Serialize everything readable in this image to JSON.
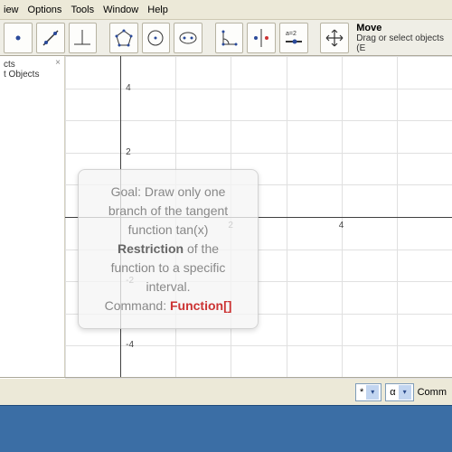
{
  "menu": {
    "items": [
      "iew",
      "Options",
      "Tools",
      "Window",
      "Help"
    ]
  },
  "hint": {
    "title": "Move",
    "sub": "Drag or select objects (E"
  },
  "sidebar": {
    "line1": "cts",
    "line2": "t Objects",
    "close": "×"
  },
  "goal": {
    "l1": "Goal: Draw only one",
    "l2": "branch of the tangent",
    "l3": "function tan(x)",
    "kw": "Restriction",
    "l4": " of the",
    "l5": "function to a specific",
    "l6": "interval.",
    "cmdLabel": "Command: ",
    "fn": "Function[]"
  },
  "axis": {
    "y1": "4",
    "y2": "2",
    "y3": "-2",
    "y4": "-4",
    "x1": "2",
    "x2": "4"
  },
  "input": {
    "combo1": "*",
    "combo2": "α",
    "label": "Comm"
  },
  "chart_data": {
    "type": "line",
    "title": "",
    "xlabel": "",
    "ylabel": "",
    "xlim": [
      -1,
      6
    ],
    "ylim": [
      -5,
      5
    ],
    "xticks": [
      2,
      4
    ],
    "yticks": [
      -4,
      -2,
      2,
      4
    ],
    "series": []
  }
}
